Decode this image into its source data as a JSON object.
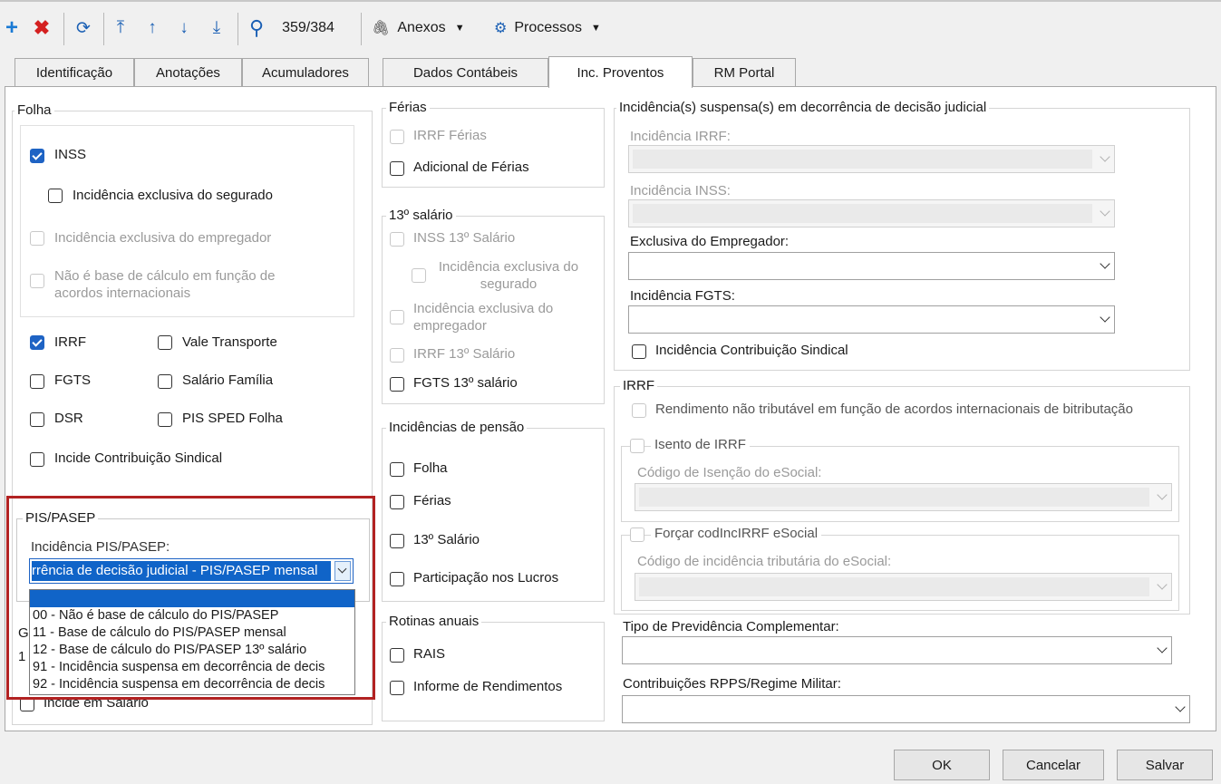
{
  "toolbar": {
    "counter": "359/384",
    "anexos": "Anexos",
    "processos": "Processos",
    "colors": {
      "add": "#1a7ad4",
      "delete": "#d42020",
      "nav": "#1a5fb4"
    }
  },
  "tabs": [
    "Identificação",
    "Anotações",
    "Acumuladores",
    "Dados Contábeis",
    "Inc. Proventos",
    "RM Portal"
  ],
  "folha": {
    "title": "Folha",
    "inss": "INSS",
    "inc_seg": "Incidência exclusiva do segurado",
    "inc_emp": "Incidência exclusiva do empregador",
    "nao_base": "Não é base de cálculo em função de acordos internacionais",
    "irrf": "IRRF",
    "fgts": "FGTS",
    "dsr": "DSR",
    "vale": "Vale Transporte",
    "sal_fam": "Salário Família",
    "pis_sped": "PIS SPED Folha",
    "sindical": "Incide Contribuição Sindical"
  },
  "pis": {
    "title": "PIS/PASEP",
    "label": "Incidência PIS/PASEP:",
    "value": "rrência de decisão judicial - PIS/PASEP mensal",
    "options": [
      "",
      "00 - Não é base de cálculo do PIS/PASEP",
      "11 - Base de cálculo do PIS/PASEP mensal",
      "12 - Base de cálculo do PIS/PASEP 13º salário",
      "91 - Incidência suspensa em decorrência de decis",
      "92 - Incidência suspensa em decorrência de decis"
    ]
  },
  "hidden": {
    "g": "G",
    "one": "1",
    "incide": "Incide em Salário"
  },
  "ferias": {
    "title": "Férias",
    "irrf": "IRRF Férias",
    "adicional": "Adicional de Férias"
  },
  "decimo": {
    "title": "13º salário",
    "inss": "INSS 13º Salário",
    "inc_seg": "Incidência exclusiva do segurado",
    "inc_emp": "Incidência exclusiva do empregador",
    "irrf": "IRRF 13º Salário",
    "fgts": "FGTS 13º salário"
  },
  "pensao": {
    "title": "Incidências de pensão",
    "folha": "Folha",
    "ferias": "Férias",
    "decimo": "13º Salário",
    "lucros": "Participação nos Lucros"
  },
  "rotinas": {
    "title": "Rotinas anuais",
    "rais": "RAIS",
    "informe": "Informe de Rendimentos"
  },
  "judicial": {
    "title": "Incidência(s) suspensa(s) em decorrência de decisão judicial",
    "irrf": "Incidência IRRF:",
    "inss": "Incidência INSS:",
    "exclusiva": "Exclusiva do Empregador:",
    "fgts": "Incidência FGTS:",
    "sindical": "Incidência Contribuição Sindical"
  },
  "irrf": {
    "title": "IRRF",
    "rend": "Rendimento não tributável em função de acordos internacionais de bitributação",
    "isento": "Isento de IRRF",
    "cod_isencao": "Código de Isenção do eSocial:",
    "forcar": "Forçar codIncIRRF eSocial",
    "cod_inc": "Código de incidência tributária do eSocial:"
  },
  "previdencia": {
    "label": "Tipo de Previdência Complementar:"
  },
  "rpps": {
    "label": "Contribuições RPPS/Regime Militar:"
  },
  "buttons": {
    "ok": "OK",
    "cancel": "Cancelar",
    "save": "Salvar"
  },
  "highlight_color": "#b22222"
}
